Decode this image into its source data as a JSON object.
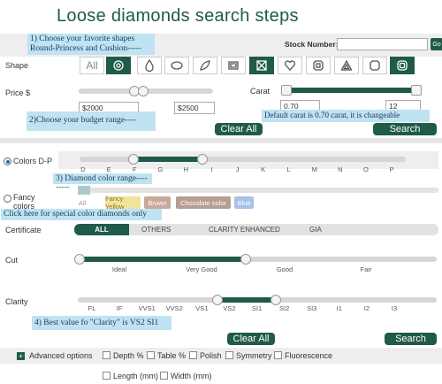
{
  "title": "Loose diamonds search steps",
  "notes": {
    "step1_line1": "1) Choose your favorite shapes",
    "step1_line2": "Round-Princess and Cushion-----",
    "step2": "2)Choose your budget range----",
    "carat_note": "Default carat is 0.70 carat, it is changeable",
    "step3": "3) Diamond color range---------",
    "fancy_note": "Click here for special color diamonds only",
    "step4": "4) Best value fo \"Clarity\" is VS2 SI1"
  },
  "stock": {
    "label": "Stock Number:",
    "go": "Go"
  },
  "shape": {
    "label": "Shape",
    "all": "All",
    "icons": [
      "round-icon",
      "pear-icon",
      "oval-icon",
      "marquise-icon",
      "emerald-icon",
      "princess-icon",
      "heart-icon",
      "asscher-icon",
      "trillion-icon",
      "radiant-icon",
      "cushion-icon"
    ],
    "selected": [
      "round-icon",
      "princess-icon",
      "cushion-icon"
    ]
  },
  "price": {
    "label": "Price $",
    "min": "$2000",
    "max": "$2500"
  },
  "carat": {
    "label": "Carat",
    "min": "0.70",
    "max": "12"
  },
  "buttons": {
    "clear_all": "Clear All",
    "search": "Search"
  },
  "colors": {
    "label": "Colors D-P",
    "grades": [
      "D",
      "E",
      "F",
      "G",
      "H",
      "I",
      "J",
      "K",
      "L",
      "M",
      "N",
      "O",
      "P"
    ],
    "selected_range": [
      "F",
      "H"
    ]
  },
  "fancy": {
    "label_line1": "Fancy",
    "label_line2": "colors",
    "chips": [
      "All",
      "Fancy Yellow",
      "Brown",
      "Chocolate color",
      "Blue"
    ]
  },
  "certificate": {
    "label": "Certificate",
    "options": [
      "ALL",
      "OTHERS",
      "CLARITY ENHANCED",
      "GIA"
    ],
    "selected": "ALL"
  },
  "cut": {
    "label": "Cut",
    "grades": [
      "Ideal",
      "Very Good",
      "Good",
      "Fair"
    ]
  },
  "clarity": {
    "label": "Clarity",
    "grades": [
      "FL",
      "IF",
      "VVS1",
      "VVS2",
      "VS1",
      "VS2",
      "SI1",
      "SI2",
      "SI3",
      "I1",
      "I2",
      "I3"
    ],
    "selected_range": [
      "VS2",
      "SI1"
    ]
  },
  "advanced": {
    "label": "Advanced options",
    "options": [
      "Depth %",
      "Table %",
      "Polish",
      "Symmetry",
      "Fluorescence",
      "Length (mm)",
      "Width (mm)"
    ]
  },
  "colors_theme": {
    "accent": "#1f5a4a",
    "note_bg": "#bfe3f1"
  }
}
